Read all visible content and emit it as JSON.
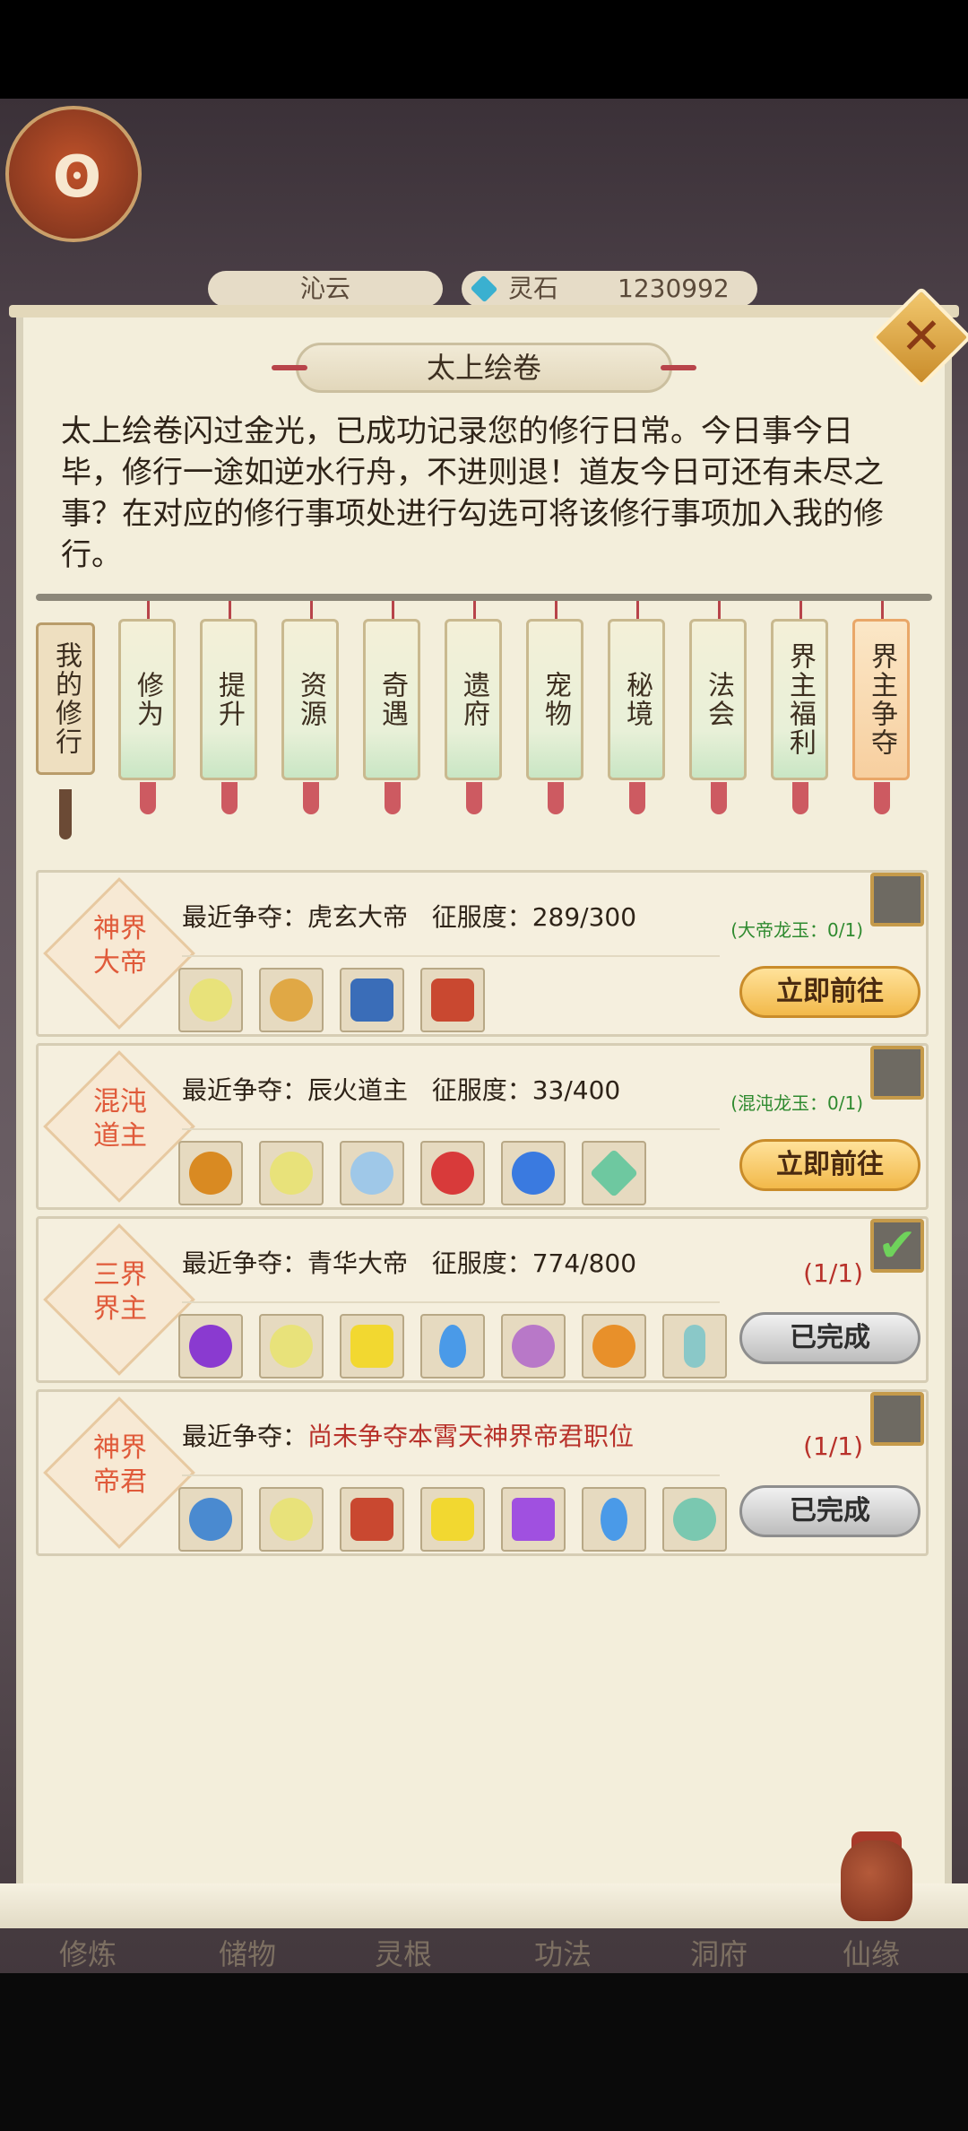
{
  "top_bar": {
    "player_name": "沁云",
    "currency_label": "灵石",
    "currency_value": "1230992"
  },
  "dialog": {
    "title": "太上绘卷",
    "intro": "太上绘卷闪过金光，已成功记录您的修行日常。今日事今日毕，修行一途如逆水行舟，不进则退！道友今日可还有未尽之事？在对应的修行事项处进行勾选可将该修行事项加入我的修行。",
    "close_icon": "close-icon"
  },
  "tabs": [
    {
      "label": "我的修行"
    },
    {
      "label": "修为"
    },
    {
      "label": "提升"
    },
    {
      "label": "资源"
    },
    {
      "label": "奇遇"
    },
    {
      "label": "遗府"
    },
    {
      "label": "宠物"
    },
    {
      "label": "秘境"
    },
    {
      "label": "法会"
    },
    {
      "label": "界主福利"
    },
    {
      "label": "界主争夺",
      "active": true
    }
  ],
  "cards": [
    {
      "badge": "神界\n大帝",
      "prefix": "最近争夺：",
      "holder": "虎玄大帝",
      "conquest": "征服度：289/300",
      "status": "(大帝龙玉：0/1)",
      "button": "立即前往",
      "checked": false,
      "items": [
        {
          "icon": "golden-orb-icon",
          "color": "#e8e27a"
        },
        {
          "icon": "fire-altar-icon",
          "color": "#e0a845"
        },
        {
          "icon": "treasure-chest-icon",
          "color": "#3a6db8"
        },
        {
          "icon": "red-chest-icon",
          "color": "#c94830"
        }
      ]
    },
    {
      "badge": "混沌\n道主",
      "prefix": "最近争夺：",
      "holder": "辰火道主",
      "conquest": "征服度：33/400",
      "status": "(混沌龙玉：0/1)",
      "button": "立即前往",
      "checked": false,
      "items": [
        {
          "icon": "flame-bowl-icon",
          "color": "#d98a22"
        },
        {
          "icon": "golden-orb-stars-icon",
          "color": "#e8e27a"
        },
        {
          "icon": "feather-icon",
          "color": "#9fc8e8"
        },
        {
          "icon": "red-flame-icon",
          "color": "#d83a3a"
        },
        {
          "icon": "blue-orb-icon",
          "color": "#3a7ae0"
        },
        {
          "icon": "green-crystal-icon",
          "color": "#6ec8a0"
        }
      ]
    },
    {
      "badge": "三界\n界主",
      "prefix": "最近争夺：",
      "holder": "青华大帝",
      "conquest": "征服度：774/800",
      "status": "(1/1)",
      "button": "已完成",
      "checked": true,
      "items": [
        {
          "icon": "purple-seal-icon",
          "color": "#8a3ad0"
        },
        {
          "icon": "golden-orb-icon",
          "color": "#e8e27a"
        },
        {
          "icon": "yellow-stone-icon",
          "color": "#f2d830"
        },
        {
          "icon": "blue-droplet-icon",
          "color": "#4a9ae8"
        },
        {
          "icon": "herb-icon",
          "color": "#b878c8"
        },
        {
          "icon": "golden-flower-icon",
          "color": "#e8902a"
        },
        {
          "icon": "spirit-sword-icon",
          "color": "#8ac8c8"
        }
      ]
    },
    {
      "badge": "神界\n帝君",
      "prefix": "最近争夺：",
      "holder": "尚未争夺本霄天神界帝君职位",
      "conquest": "",
      "status": "(1/1)",
      "button": "已完成",
      "checked": false,
      "items": [
        {
          "icon": "blue-dragon-icon",
          "color": "#4a8ad0"
        },
        {
          "icon": "golden-orb-icon",
          "color": "#e8e27a"
        },
        {
          "icon": "red-chest-icon",
          "color": "#c94830"
        },
        {
          "icon": "yellow-stone-icon",
          "color": "#f2d830"
        },
        {
          "icon": "purple-crystal-icon",
          "color": "#a050e0"
        },
        {
          "icon": "blue-droplet-icon",
          "color": "#4a9ae8"
        },
        {
          "icon": "pet-gourd-icon",
          "color": "#7ac8b0"
        }
      ]
    }
  ],
  "bottom_nav": [
    "修炼",
    "储物",
    "灵根",
    "功法",
    "洞府",
    "仙缘"
  ]
}
